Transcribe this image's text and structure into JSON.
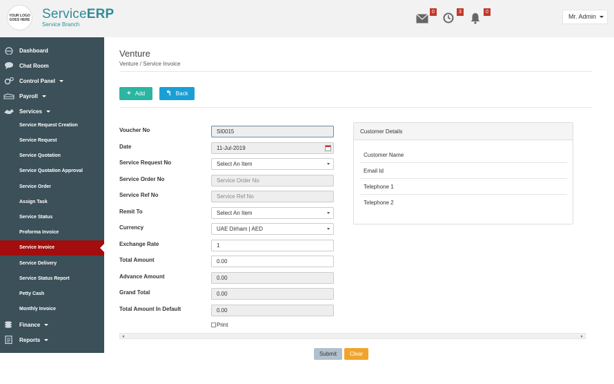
{
  "header": {
    "logo_lines": [
      "YOUR LOGO",
      "GOES HERE"
    ],
    "brand_name_light": "Service",
    "brand_name_bold": "ERP",
    "brand_sub": "Service Branch",
    "mail_badge": "0",
    "clock_badge": "3",
    "bell_badge": "0",
    "user_label": "Mr. Admin"
  },
  "sidebar": {
    "main_items": [
      {
        "label": "Dashboard",
        "icon": "dashboard-icon"
      },
      {
        "label": "Chat Room",
        "icon": "chat-icon"
      },
      {
        "label": "Control Panel",
        "icon": "gears-icon"
      },
      {
        "label": "Payroll",
        "icon": "payroll-icon"
      },
      {
        "label": "Services",
        "icon": "handshake-icon"
      }
    ],
    "sub_items": [
      "Service Request Creation",
      "Service Request",
      "Service Quotation",
      "Service Quotation Approval",
      "Service Order",
      "Assign Task",
      "Service Status",
      "Proforma Invoice",
      "Service Invoice",
      "Service Delivery",
      "Service Status Report",
      "Petty Cash",
      "Monthly Invoice"
    ],
    "bottom_items": [
      {
        "label": "Finance",
        "icon": "coins-icon"
      },
      {
        "label": "Reports",
        "icon": "report-icon"
      }
    ],
    "active": "Service Invoice",
    "active_color": "#a30d0d"
  },
  "main": {
    "title": "Venture",
    "breadcrumb": "Venture / Service Invoice",
    "add_label": "Add",
    "back_label": "Back"
  },
  "form": {
    "labels": {
      "voucher_no": "Voucher No",
      "date": "Date",
      "service_request_no": "Service Request No",
      "service_order_no": "Service Order No",
      "service_ref_no": "Service Ref No",
      "remit_to": "Remit To",
      "currency": "Currency",
      "exchange_rate": "Exchange Rate",
      "total_amount": "Total Amount",
      "advance_amount": "Advance Amount",
      "grand_total": "Grand Total",
      "total_amount_default": "Total Amount In Default"
    },
    "values": {
      "voucher_no": "SI0015",
      "date": "11-Jul-2019",
      "service_request_no": "Select An Item",
      "service_order_no_placeholder": "Service Order No",
      "service_ref_no_placeholder": "Service Ref No",
      "remit_to": "Select An Item",
      "currency": "UAE Dirham | AED",
      "exchange_rate": "1",
      "total_amount": "0.00",
      "advance_amount": "0.00",
      "grand_total": "0.00",
      "total_amount_default": "0.00"
    },
    "print_label": "Print"
  },
  "customer": {
    "title": "Customer Details",
    "rows": [
      "Customer Name",
      "Email Id",
      "Telephone 1",
      "Telephone 2"
    ]
  },
  "actions": {
    "submit_label": "Submit",
    "clear_label": "Clear"
  }
}
